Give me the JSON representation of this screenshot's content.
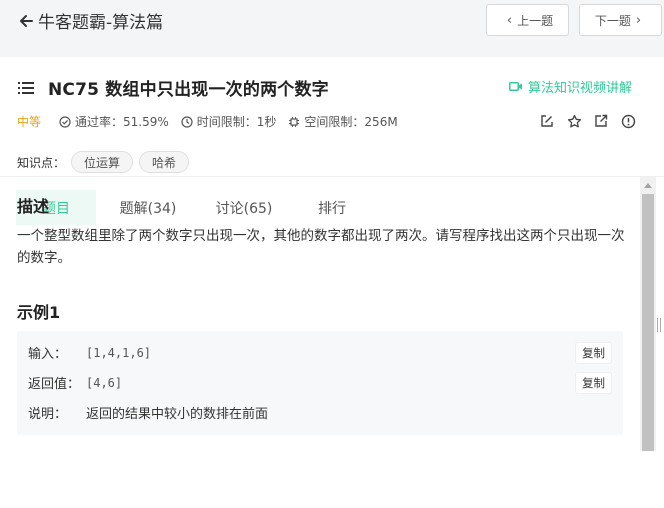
{
  "header": {
    "back_label": "牛客题霸-算法篇",
    "prev_label": "上一题",
    "next_label": "下一题"
  },
  "problem": {
    "title": "NC75  数组中只出现一次的两个数字",
    "video_link": "算法知识视频讲解",
    "difficulty": "中等",
    "pass_rate": "通过率：51.59%",
    "time_limit": "时间限制：1秒",
    "memory_limit": "空间限制：256M",
    "knowledge_label": "知识点：",
    "tags": [
      "位运算",
      "哈希"
    ]
  },
  "tabs": [
    {
      "label": "题目",
      "active": true
    },
    {
      "label": "题解(34)",
      "active": false
    },
    {
      "label": "讨论(65)",
      "active": false
    },
    {
      "label": "排行",
      "active": false
    }
  ],
  "content": {
    "desc_heading": "描述",
    "desc_text": "一个整型数组里除了两个数字只出现一次，其他的数字都出现了两次。请写程序找出这两个只出现一次的数字。",
    "example_heading": "示例1",
    "input_label": "输入：",
    "input_value": "[1,4,1,6]",
    "output_label": "返回值：",
    "output_value": "[4,6]",
    "explain_label": "说明：",
    "explain_text": "返回的结果中较小的数排在前面",
    "copy_label": "复制"
  },
  "colors": {
    "accent": "#32ca99",
    "difficulty": "#e8a317"
  }
}
